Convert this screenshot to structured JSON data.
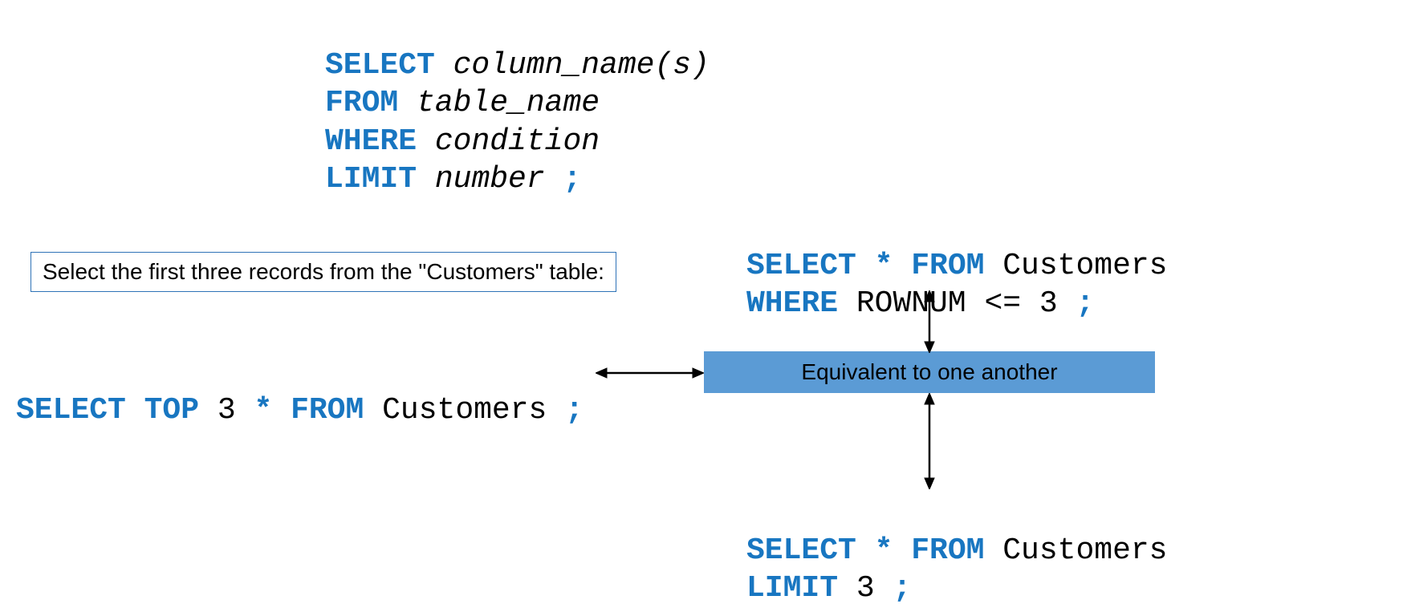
{
  "syntax": {
    "line1_kw": "SELECT",
    "line1_txt": " column_name(s)",
    "line2_kw": "FROM",
    "line2_txt": " table_name",
    "line3_kw": "WHERE",
    "line3_txt": " condition",
    "line4_kw": "LIMIT",
    "line4_txt": " number ",
    "line4_semi": ";"
  },
  "label": "Select the first three records from the \"Customers\" table:",
  "example_left": {
    "kw1": "SELECT TOP",
    "txt1": " 3 ",
    "kw2": "* FROM",
    "txt2": " Customers ",
    "kw3": ";"
  },
  "example_tr": {
    "l1_kw1": "SELECT * FROM",
    "l1_txt1": " Customers",
    "l2_kw1": "WHERE",
    "l2_txt1": " ROWNUM <= 3 ",
    "l2_kw2": ";"
  },
  "equiv": "Equivalent to one another",
  "example_br": {
    "l1_kw1": "SELECT * FROM",
    "l1_txt1": " Customers",
    "l2_kw1": "LIMIT",
    "l2_txt1": " 3 ",
    "l2_kw2": ";"
  }
}
